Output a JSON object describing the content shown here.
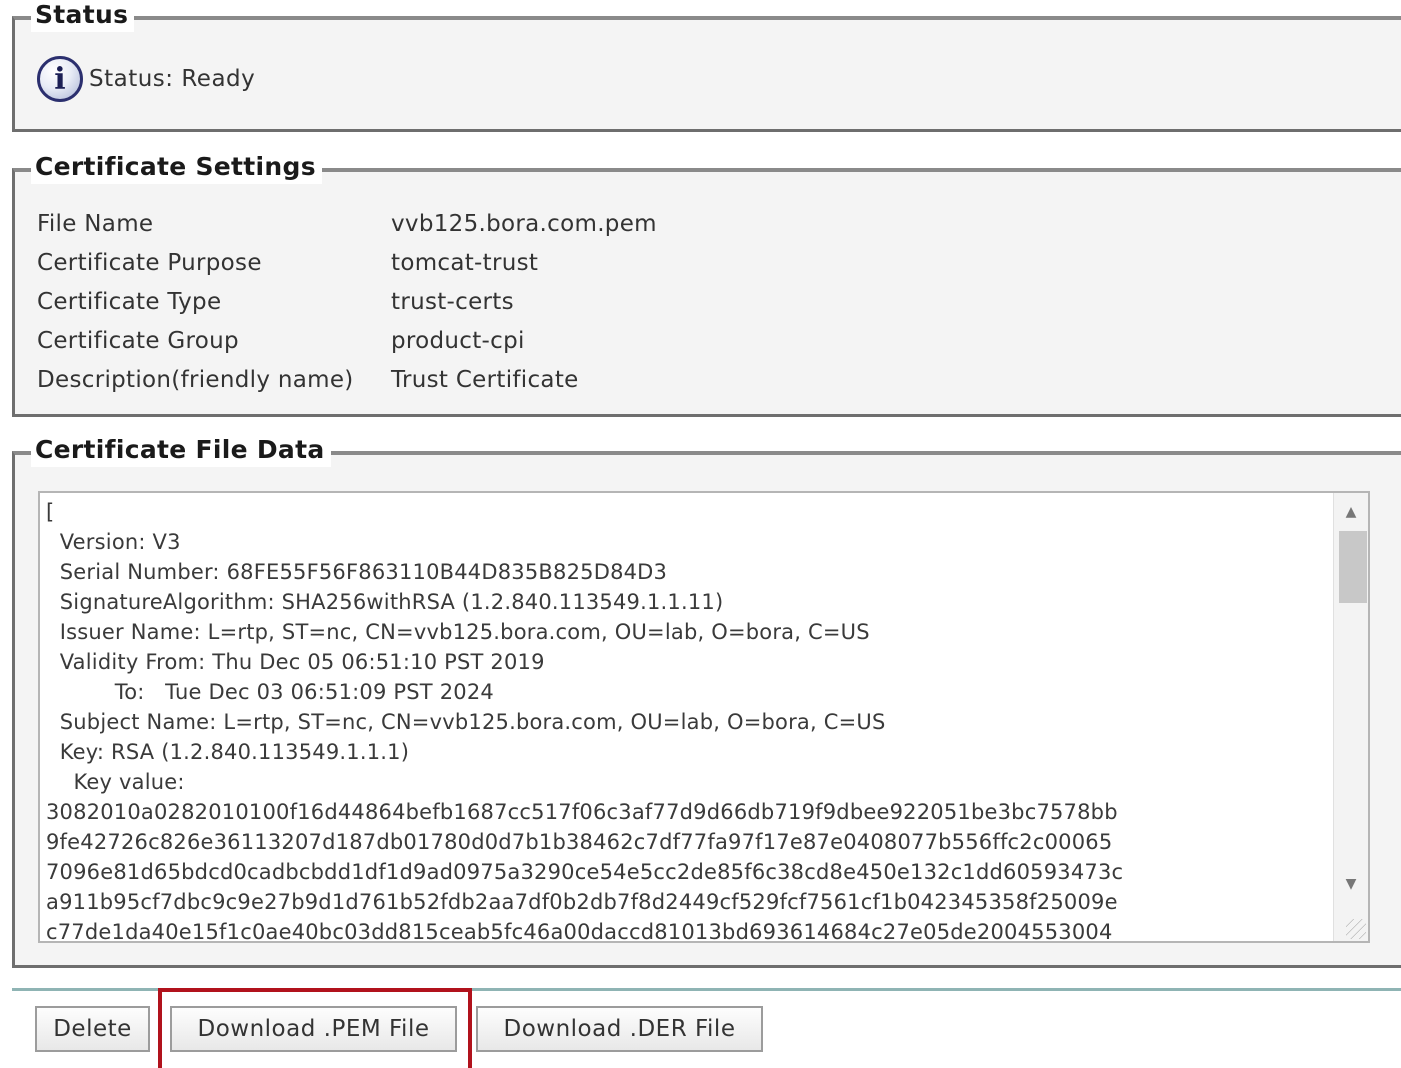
{
  "status": {
    "legend": "Status",
    "icon": "info-icon",
    "text": "Status: Ready"
  },
  "settings": {
    "legend": "Certificate Settings",
    "rows": [
      {
        "label": "File Name",
        "value": "vvb125.bora.com.pem"
      },
      {
        "label": "Certificate Purpose",
        "value": "tomcat-trust"
      },
      {
        "label": "Certificate Type",
        "value": "trust-certs"
      },
      {
        "label": "Certificate Group",
        "value": "product-cpi"
      },
      {
        "label": "Description(friendly name)",
        "value": "Trust Certificate"
      }
    ]
  },
  "file_data": {
    "legend": "Certificate File Data",
    "content": "[\n  Version: V3\n  Serial Number: 68FE55F56F863110B44D835B825D84D3\n  SignatureAlgorithm: SHA256withRSA (1.2.840.113549.1.1.11)\n  Issuer Name: L=rtp, ST=nc, CN=vvb125.bora.com, OU=lab, O=bora, C=US\n  Validity From: Thu Dec 05 06:51:10 PST 2019\n          To:   Tue Dec 03 06:51:09 PST 2024\n  Subject Name: L=rtp, ST=nc, CN=vvb125.bora.com, OU=lab, O=bora, C=US\n  Key: RSA (1.2.840.113549.1.1.1)\n    Key value:\n3082010a0282010100f16d44864befb1687cc517f06c3af77d9d66db719f9dbee922051be3bc7578bb\n9fe42726c826e36113207d187db01780d0d7b1b38462c7df77fa97f17e87e0408077b556ffc2c00065\n7096e81d65bdcd0cadbcbdd1df1d9ad0975a3290ce54e5cc2de85f6c38cd8e450e132c1dd60593473c\na911b95cf7dbc9c9e27b9d1d761b52fdb2aa7df0b2db7f8d2449cf529fcf7561cf1b042345358f25009e\nc77de1da40e15f1c0ae40bc03dd815ceab5fc46a00daccd81013bd693614684c27e05de2004553004"
  },
  "buttons": {
    "delete": "Delete",
    "download_pem": "Download .PEM File",
    "download_der": "Download .DER File"
  },
  "colors": {
    "highlight_box": "#b1121c",
    "toolbar_line": "#8fb4b4"
  }
}
